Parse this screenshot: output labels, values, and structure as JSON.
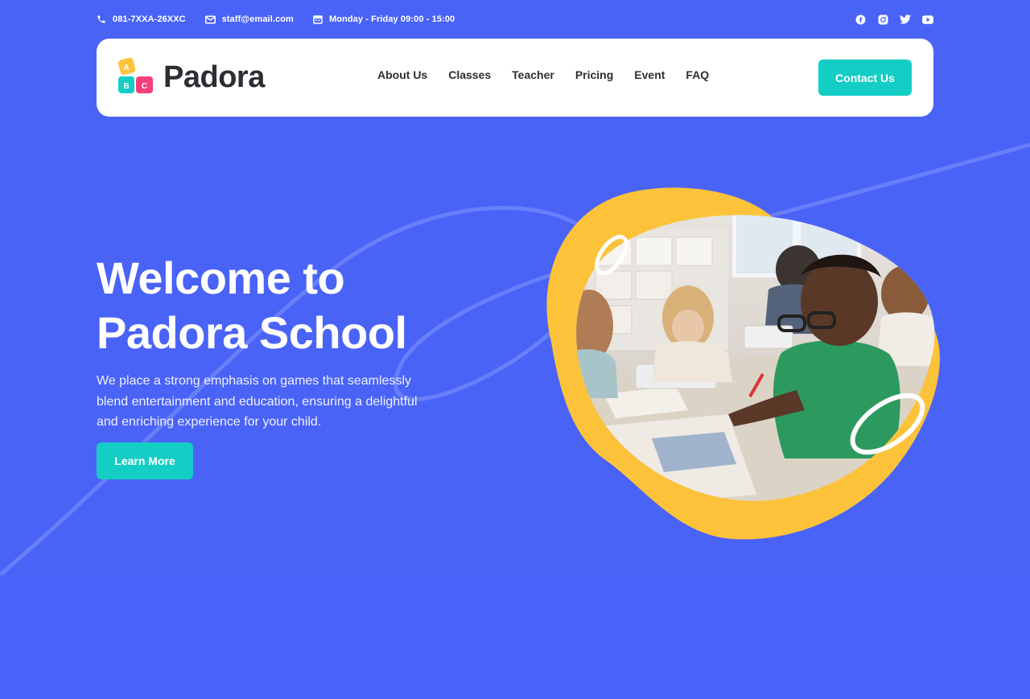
{
  "topbar": {
    "phone": "081-7XXA-26XXC",
    "email": "staff@email.com",
    "hours": "Monday - Friday 09:00 - 15:00",
    "socials": [
      "facebook-icon",
      "instagram-icon",
      "twitter-icon",
      "youtube-icon"
    ]
  },
  "navbar": {
    "logo_text": "Padora",
    "logo_blocks": [
      "A",
      "B",
      "C"
    ],
    "links": [
      "About Us",
      "Classes",
      "Teacher",
      "Pricing",
      "Event",
      "FAQ"
    ],
    "cta_label": "Contact Us"
  },
  "hero": {
    "title_line1": "Welcome to",
    "title_line2": "Padora School",
    "description": "We place a strong emphasis on games that seamlessly blend entertainment and education, ensuring a delightful and enriching experience for your child.",
    "button_label": "Learn More"
  },
  "colors": {
    "background": "#4a63f7",
    "accent": "#14cdc4",
    "blob": "#fcc33a",
    "text_dark": "#2d2d33"
  }
}
